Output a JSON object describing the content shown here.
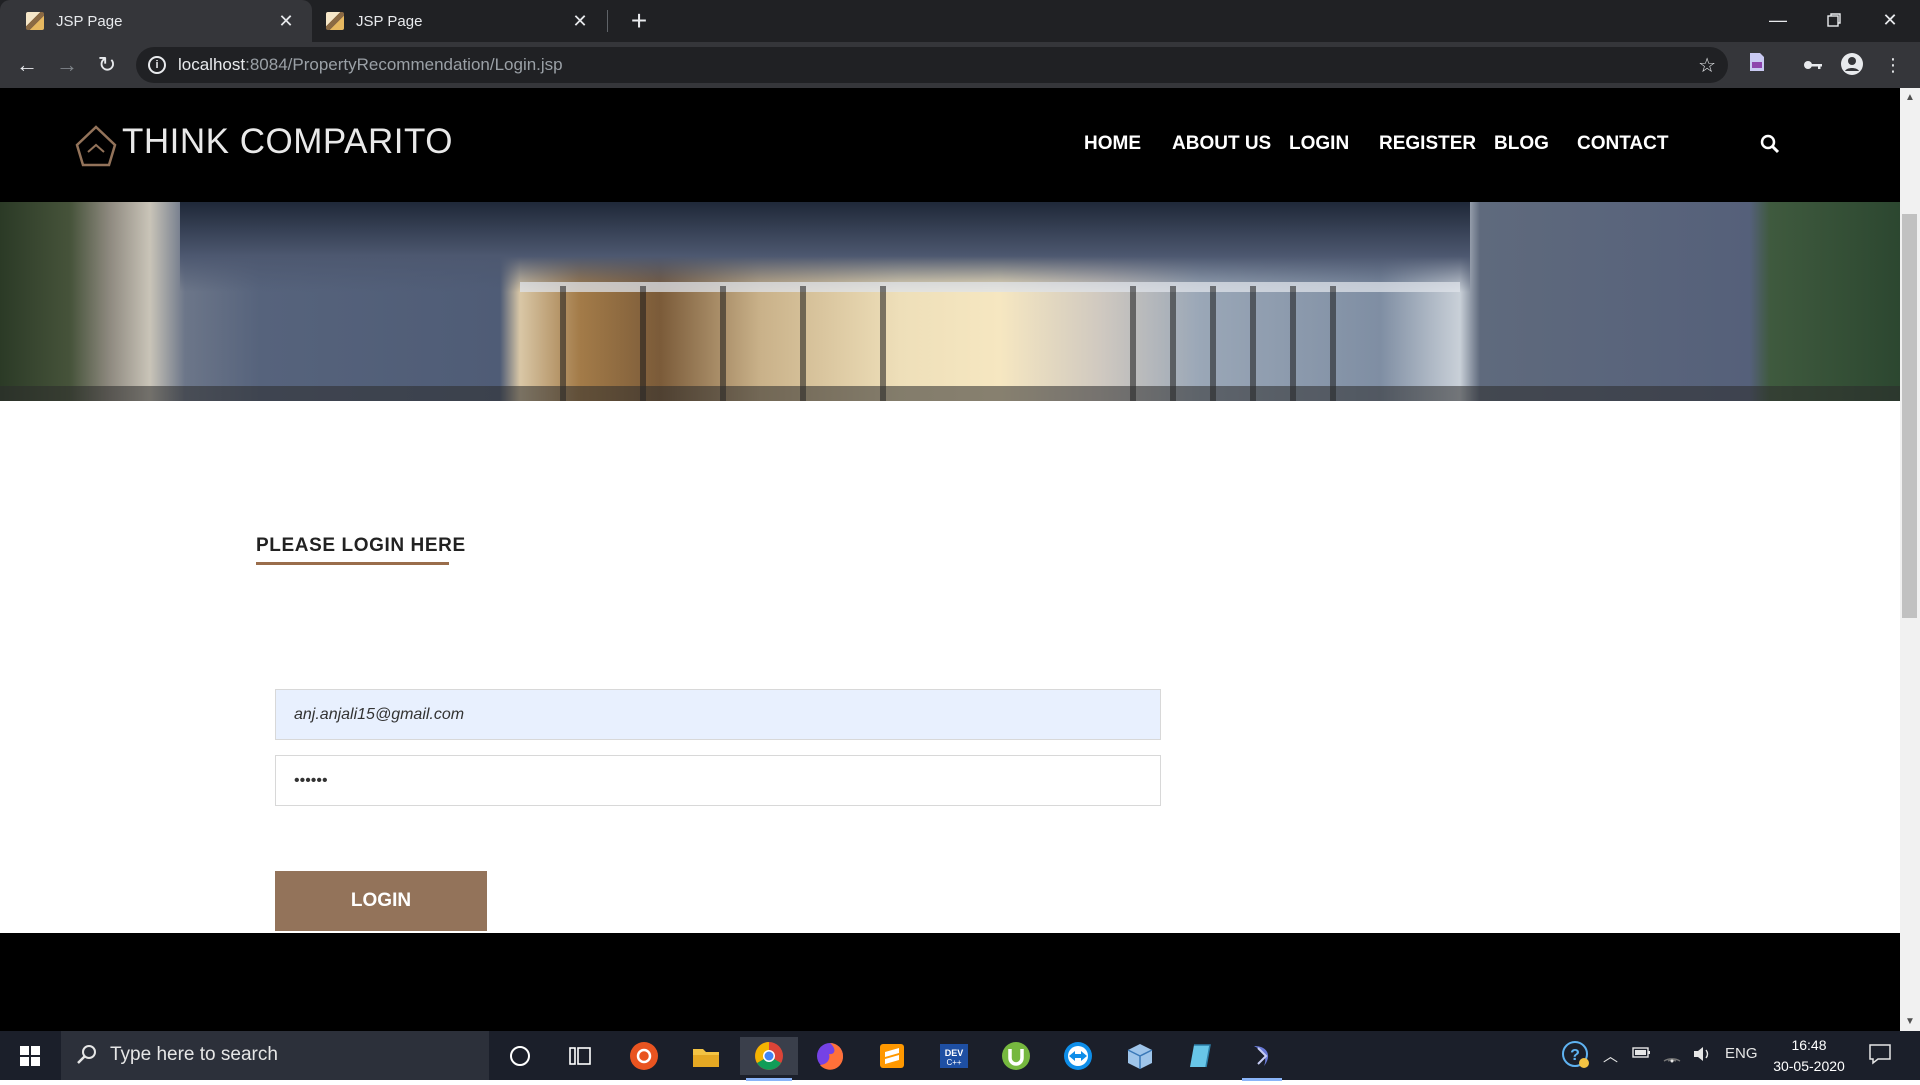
{
  "browser": {
    "tabs": [
      {
        "title": "JSP Page",
        "active": true
      },
      {
        "title": "JSP Page",
        "active": false
      }
    ],
    "address": {
      "host": "localhost",
      "path": ":8084/PropertyRecommendation/Login.jsp"
    }
  },
  "site": {
    "brand": "THINK COMPARITO",
    "nav": [
      "HOME",
      "ABOUT US",
      "LOGIN",
      "REGISTER",
      "BLOG",
      "CONTACT"
    ],
    "login": {
      "heading": "PLEASE LOGIN HERE",
      "email_value": "anj.anjali15@gmail.com",
      "password_value": "••••••",
      "button_label": "LOGIN"
    },
    "colors": {
      "accent": "#93735a",
      "underline": "#9a6d4b",
      "header_bg": "#000000",
      "autofill_bg": "#e8f0fe"
    }
  },
  "taskbar": {
    "search_placeholder": "Type here to search",
    "language": "ENG",
    "time": "16:48",
    "date": "30-05-2020",
    "pinned_apps": [
      "cortana-icon",
      "task-view-icon",
      "ubuntu-icon",
      "file-explorer-icon",
      "chrome-icon",
      "firefox-icon",
      "sublime-text-icon",
      "devcpp-icon",
      "utorrent-icon",
      "teamviewer-icon",
      "virtualbox-icon",
      "notepad-icon",
      "netbeans-icon"
    ]
  }
}
